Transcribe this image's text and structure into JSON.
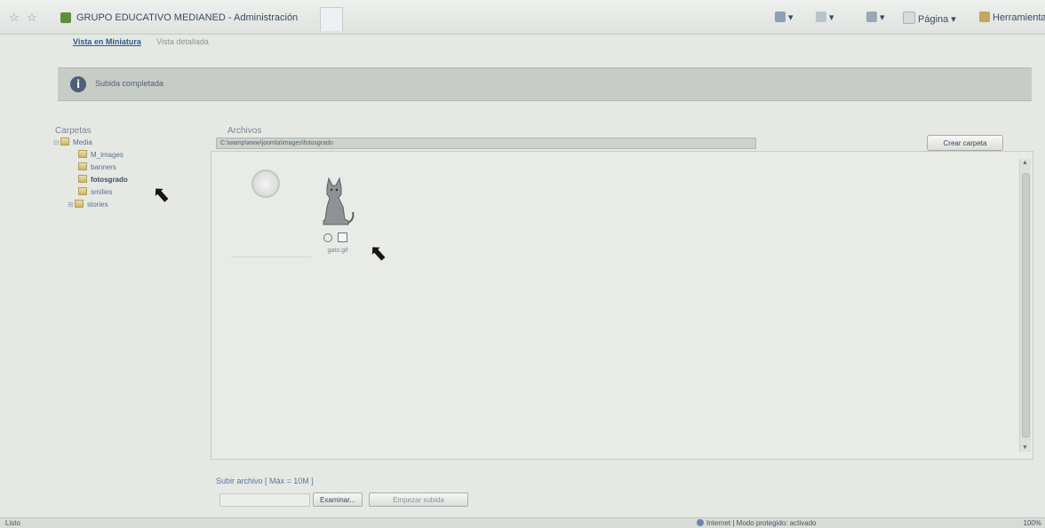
{
  "toolbar": {
    "back_icon": "back-arrow-icon",
    "forward_icon": "forward-arrow-icon",
    "page_title": "GRUPO EDUCATIVO MEDIANED - Administración",
    "home_label": "▾",
    "feeds_label": "▾",
    "print_label": "▾",
    "page_menu": "Página ▾",
    "tools_menu": "Herramienta"
  },
  "view_tabs": {
    "thumbnail": "Vista en Miniatura",
    "detailed": "Vista detallada"
  },
  "notice": {
    "icon": "i",
    "message": "Subida completada"
  },
  "folders": {
    "title": "Carpetas",
    "root": "Media",
    "items": [
      {
        "label": "M_images",
        "selected": false
      },
      {
        "label": "banners",
        "selected": false
      },
      {
        "label": "fotosgrado",
        "selected": true
      },
      {
        "label": "smilies",
        "selected": false
      },
      {
        "label": "stories",
        "selected": false,
        "expandable": true
      }
    ]
  },
  "files": {
    "title": "Archivos",
    "path": "C:\\wamp\\www\\joomla\\images\\fotosgrado",
    "create_folder_button": "Crear carpeta",
    "image_caption": "gato.gif"
  },
  "upload": {
    "title": "Subir archivo [ Máx = 10M ]",
    "browse_button": "Examinar...",
    "start_button": "Empezar subida"
  },
  "statusbar": {
    "left": "Listo",
    "zone": "Internet | Modo protegido: activado",
    "zoom": "100%"
  }
}
